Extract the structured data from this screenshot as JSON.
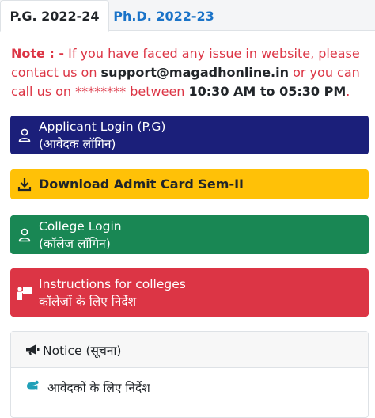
{
  "tabs": [
    {
      "label": "P.G. 2022-24",
      "active": true
    },
    {
      "label": "Ph.D. 2022-23",
      "active": false
    }
  ],
  "note": {
    "lead": "Note : -",
    "part1": " If you have faced any issue in website, please contact us on ",
    "email": "support@magadhonline.in",
    "part2": " or you can call us on ******** between ",
    "time": "10:30 AM to 05:30 PM",
    "end": "."
  },
  "buttons": {
    "applicant": {
      "line1": "Applicant Login (P.G)",
      "line2": "(आवेदक लॉगिन)",
      "icon": "user-icon",
      "color": "#1b1f7a"
    },
    "admit": {
      "label": "Download Admit Card Sem-II",
      "icon": "download-icon",
      "color": "#ffc107"
    },
    "college": {
      "line1": "College Login",
      "line2": "(कॉलेज लॉगिन)",
      "icon": "user-icon",
      "color": "#198754"
    },
    "instructions": {
      "line1": "Instructions for colleges",
      "line2": "कॉलेजों के लिए निर्देश",
      "icon": "presenter-icon",
      "color": "#dc3545"
    }
  },
  "notice": {
    "title": "Notice (सूचना)",
    "icon": "bullhorn-icon",
    "items": [
      {
        "label": "आवेदकों के लिए निर्देश",
        "icon": "info-hand-icon"
      }
    ]
  }
}
